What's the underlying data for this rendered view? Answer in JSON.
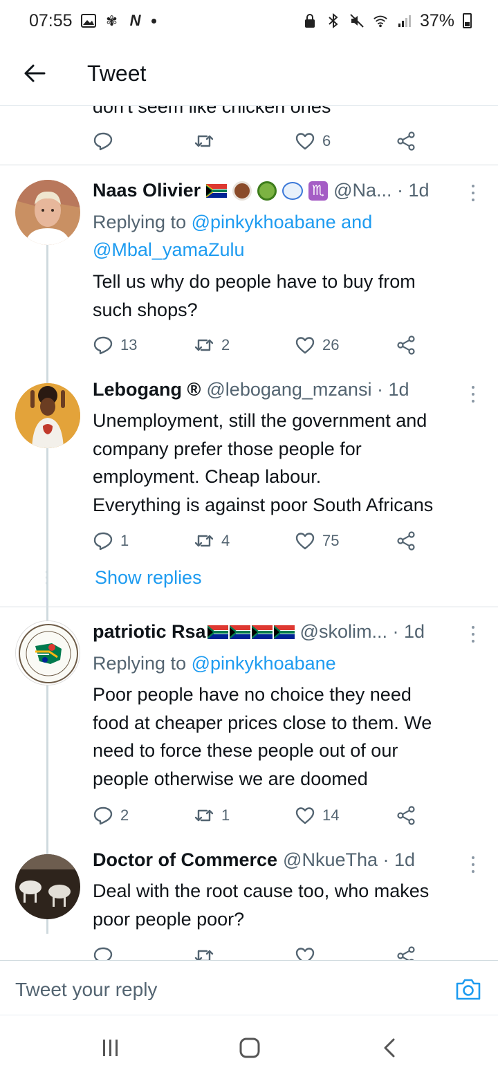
{
  "status_bar": {
    "time": "07:55",
    "battery": "37%"
  },
  "header": {
    "title": "Tweet"
  },
  "top_tweet": {
    "cut_text": "don't seem like chicken ones",
    "likes": "6"
  },
  "tweets": [
    {
      "name": "Naas Olivier",
      "meta": "@Na... · 1d",
      "replying_prefix": "Replying to",
      "replying_line1": "@pinkykhoabane and",
      "replying_line2": "@Mbal_yamaZulu",
      "text_lines": [
        "Tell us why do people have to buy from",
        "such shops?"
      ],
      "replies": "13",
      "retweets": "2",
      "likes": "26"
    },
    {
      "name": "Lebogang ®",
      "meta": "@lebogang_mzansi · 1d",
      "text_lines": [
        "Unemployment, still the government and",
        "company prefer those people for",
        "employment. Cheap labour.",
        "Everything is against poor South Africans"
      ],
      "replies": "1",
      "retweets": "4",
      "likes": "75",
      "show_replies": "Show replies"
    },
    {
      "name": "patriotic Rsa",
      "meta": "@skolim... · 1d",
      "replying_prefix": "Replying to",
      "replying_line1": "@pinkykhoabane",
      "text_lines": [
        "Poor people have no choice they need",
        "food at cheaper prices close to them. We",
        "need to force these people out of our",
        "people otherwise we are doomed"
      ],
      "replies": "2",
      "retweets": "1",
      "likes": "14"
    },
    {
      "name": "Doctor of Commerce",
      "meta": "@NkueTha · 1d",
      "text_lines": [
        "Deal with the root cause too, who makes",
        "poor people poor?"
      ]
    }
  ],
  "reply_bar": {
    "placeholder": "Tweet your reply"
  },
  "colors": {
    "link": "#1d9bf0",
    "muted": "#536471",
    "text": "#0f1419"
  }
}
